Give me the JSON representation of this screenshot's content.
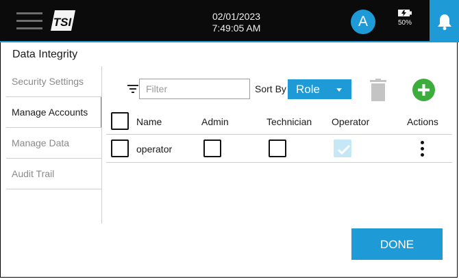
{
  "header": {
    "date": "02/01/2023",
    "time": "7:49:05 AM",
    "avatar_initial": "A",
    "battery_text": "50%",
    "logo_text": "TSI"
  },
  "page": {
    "title": "Data Integrity"
  },
  "sidebar": {
    "items": [
      {
        "label": "Security Settings"
      },
      {
        "label": "Manage Accounts"
      },
      {
        "label": "Manage Data"
      },
      {
        "label": "Audit Trail"
      }
    ],
    "active_index": 1
  },
  "toolbar": {
    "filter_placeholder": "Filter",
    "sort_by_label": "Sort By",
    "sort_value": "Role"
  },
  "table": {
    "columns": [
      "Name",
      "Admin",
      "Technician",
      "Operator",
      "Actions"
    ],
    "rows": [
      {
        "name": "operator",
        "admin": false,
        "technician": false,
        "operator": true
      }
    ]
  },
  "footer": {
    "done_label": "DONE"
  },
  "colors": {
    "accent": "#1e9bd7",
    "add": "#3cac3c",
    "topbar": "#0b0b0b"
  },
  "icons": [
    "menu-icon",
    "tsi-logo",
    "battery-icon",
    "bell-icon",
    "filter-icon",
    "trash-icon",
    "plus-icon",
    "checkmark-icon",
    "kebab-icon"
  ]
}
